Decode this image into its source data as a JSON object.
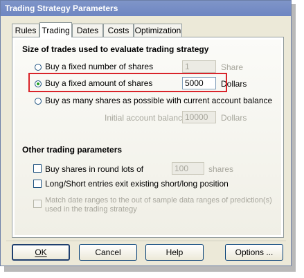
{
  "window": {
    "title": "Trading Strategy Parameters"
  },
  "tabs": [
    {
      "label": "Rules"
    },
    {
      "label": "Trading"
    },
    {
      "label": "Dates"
    },
    {
      "label": "Costs"
    },
    {
      "label": "Optimization"
    }
  ],
  "active_tab": "Trading",
  "size_section": {
    "title": "Size of trades used to evaluate trading strategy",
    "options": [
      {
        "label": "Buy a fixed number of shares",
        "value": "1",
        "unit": "Share",
        "selected": false
      },
      {
        "label": "Buy a fixed amount of shares",
        "value": "5000",
        "unit": "Dollars",
        "selected": true
      },
      {
        "label": "Buy as many shares as possible with current account balance",
        "selected": false
      }
    ],
    "initial_balance": {
      "label": "Initial account balance",
      "value": "10000",
      "unit": "Dollars"
    }
  },
  "other_section": {
    "title": "Other trading parameters",
    "round_lots": {
      "label": "Buy shares in round lots of",
      "value": "100",
      "unit": "shares",
      "checked": false
    },
    "long_short": {
      "label": "Long/Short entries exit existing short/long position",
      "checked": false
    },
    "match_dates": {
      "line1": "Match date ranges to the out of sample data ranges of prediction(s)",
      "line2": "used in the trading strategy",
      "checked": false
    }
  },
  "buttons": {
    "ok": "OK",
    "cancel": "Cancel",
    "help": "Help",
    "options": "Options ..."
  },
  "colors": {
    "highlight": "#d9242a",
    "titlebar": "#7189c4"
  }
}
